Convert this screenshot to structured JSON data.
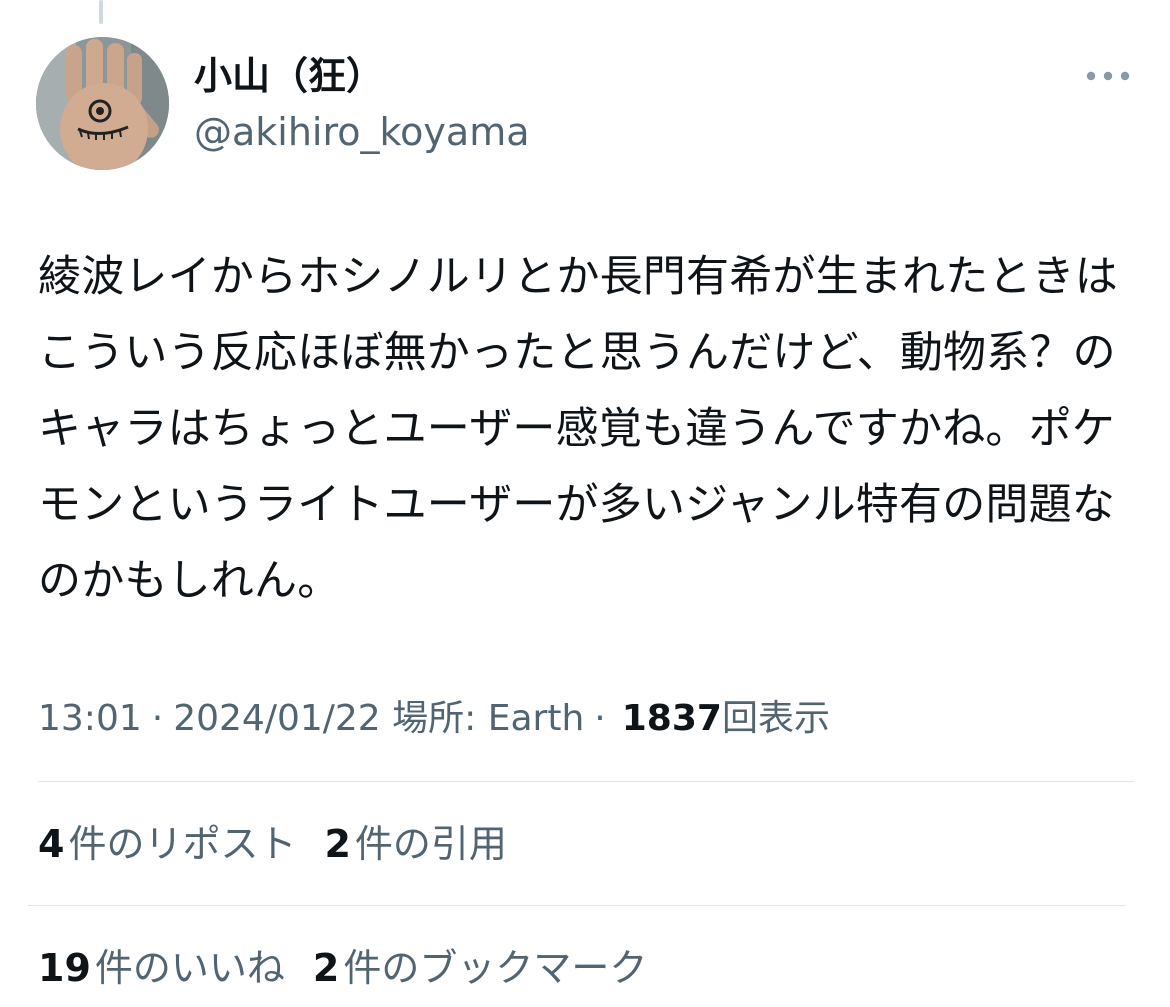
{
  "author": {
    "display_name": "小山（狂）",
    "handle": "@akihiro_koyama"
  },
  "icons": {
    "more": "more-horizontal-icon"
  },
  "tweet": {
    "text": "綾波レイからホシノルリとか長門有希が生まれたときはこういう反応ほぼ無かったと思うんだけど、動物系？のキャラはちょっとユーザー感覚も違うんですかね。ポケモンというライトユーザーが多いジャンル特有の問題なのかもしれん。"
  },
  "meta": {
    "time": "13:01",
    "separator": "·",
    "date": "2024/01/22",
    "location_label": "場所: Earth",
    "views_count": "1837",
    "views_label": "回表示"
  },
  "stats": {
    "reposts": {
      "count": "4",
      "label": "件のリポスト"
    },
    "quotes": {
      "count": "2",
      "label": "件の引用"
    },
    "likes": {
      "count": "19",
      "label": "件のいいね"
    },
    "bookmarks": {
      "count": "2",
      "label": "件のブックマーク"
    }
  },
  "colors": {
    "primary_text": "#0f1419",
    "secondary_text": "#536471",
    "divider": "#e1e6e9"
  }
}
